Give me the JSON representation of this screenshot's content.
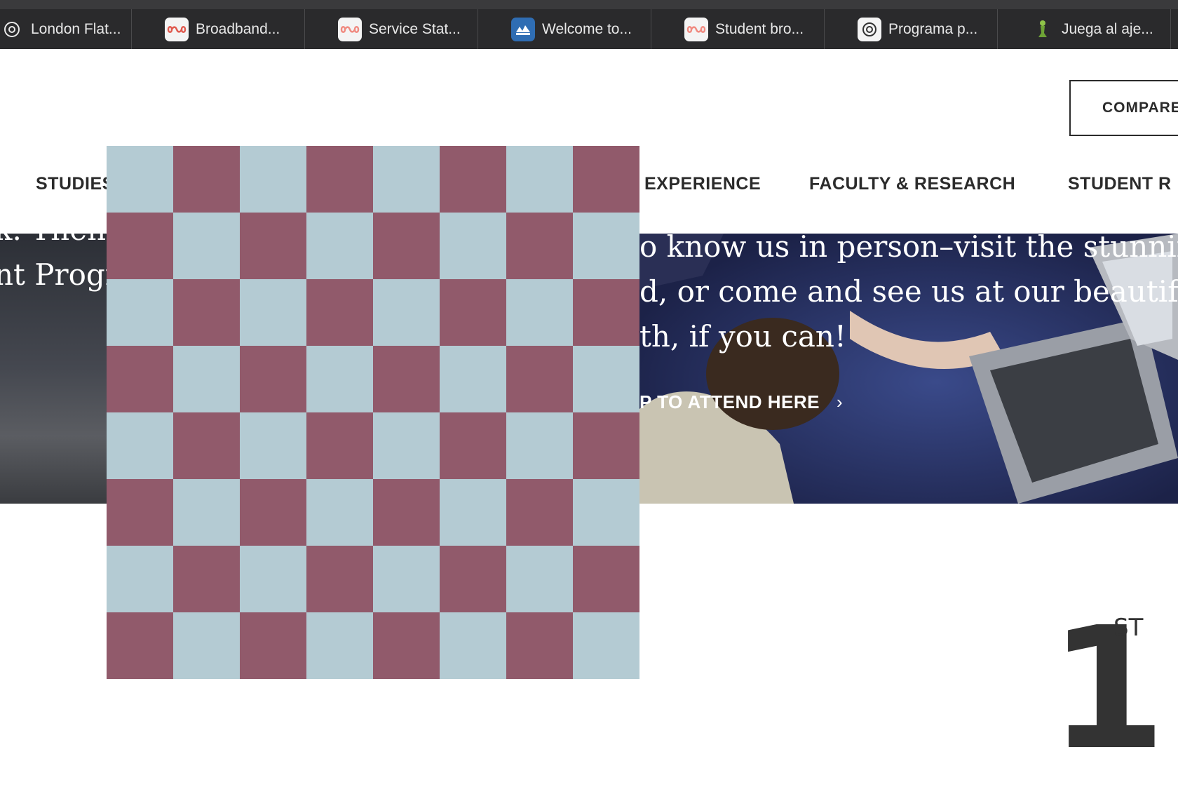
{
  "browser": {
    "tabs": [
      {
        "label": "London Flat...",
        "icon": "openai-icon"
      },
      {
        "label": "Broadband...",
        "icon": "infinity-icon"
      },
      {
        "label": "Service Stat...",
        "icon": "infinity-icon"
      },
      {
        "label": "Welcome to...",
        "icon": "chess-board-icon"
      },
      {
        "label": "Student bro...",
        "icon": "infinity-icon"
      },
      {
        "label": "Programa p...",
        "icon": "openai-icon"
      },
      {
        "label": "Juega al aje...",
        "icon": "chess-pawn-icon"
      }
    ]
  },
  "header": {
    "compare_label": "COMPARE"
  },
  "nav": {
    "items": [
      {
        "label": "STUDIES"
      },
      {
        "label": "EXPERIENCE"
      },
      {
        "label": "FACULTY & RESEARCH"
      },
      {
        "label": "STUDENT R"
      }
    ]
  },
  "hero": {
    "left_line1": "k. Then",
    "left_line2": "nt Progra",
    "right_line1": "o know us in person–visit the stunning r",
    "right_line2": "d, or come and see us at our beautiful a",
    "right_line3": "th, if you can!",
    "cta_label": "P TO ATTEND HERE",
    "cta_chevron": "›"
  },
  "ranking": {
    "number": "1",
    "suffix": "ST"
  },
  "colors": {
    "checker_light": "#b4cbd3",
    "checker_dark": "#915a6b",
    "tabbar_bg": "#2a2a2c",
    "text_dark": "#2b2b2b"
  }
}
